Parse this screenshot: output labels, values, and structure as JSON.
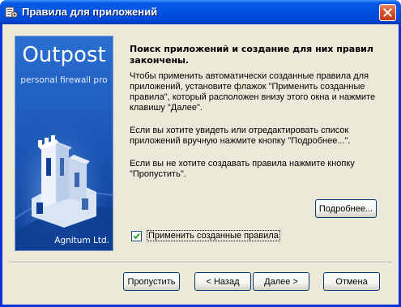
{
  "window": {
    "title": "Правила для приложений"
  },
  "banner": {
    "brand": "Outpost",
    "subtitle": "personal firewall pro",
    "vendor": "Agnitum Ltd."
  },
  "content": {
    "heading": "Поиск приложений и создание для них правил закончены.",
    "paragraph1": "Чтобы применить автоматически созданные правила для приложений, установите флажок \"Применить созданные правила\", который расположен внизу этого окна и нажмите клавишу \"Далее\".",
    "paragraph2": "Если вы хотите увидеть или отредактировать список приложений вручную нажмите кнопку \"Подробнее...\".",
    "paragraph3": "Если вы не хотите создавать правила нажмите кнопку \"Пропустить\"."
  },
  "details_button": "Подробнее...",
  "apply_checkbox": {
    "label": "Применить созданные правила",
    "checked": true
  },
  "footer": {
    "skip": "Пропустить",
    "back": "< Назад",
    "next": "Далее >",
    "cancel": "Отмена"
  },
  "colors": {
    "titlebar": "#0054e3",
    "client": "#ece9d8",
    "banner": "#1a58b8",
    "close": "#d8552d"
  }
}
